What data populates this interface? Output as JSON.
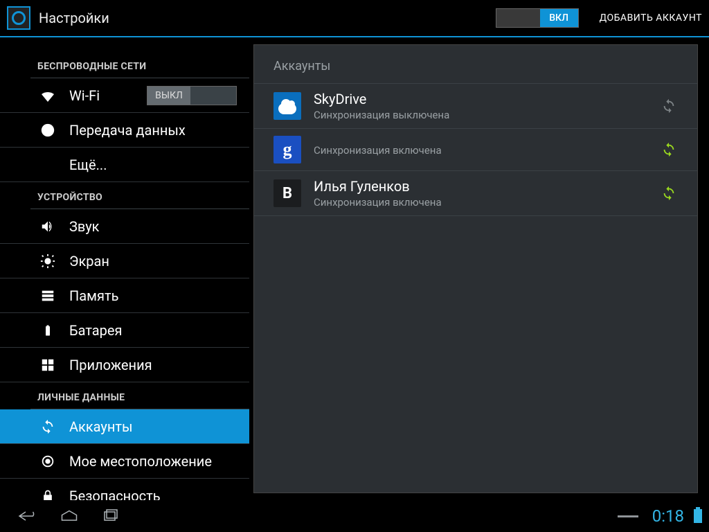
{
  "header": {
    "title": "Настройки",
    "toggle_on_label": "ВКЛ",
    "add_account": "ДОБАВИТЬ АККАУНТ"
  },
  "sidebar": {
    "section_wireless": "БЕСПРОВОДНЫЕ СЕТИ",
    "wifi": {
      "label": "Wi-Fi",
      "toggle_off": "ВЫКЛ"
    },
    "data_usage": "Передача данных",
    "more": "Ещё...",
    "section_device": "УСТРОЙСТВО",
    "sound": "Звук",
    "display": "Экран",
    "storage": "Память",
    "battery": "Батарея",
    "apps": "Приложения",
    "section_personal": "ЛИЧНЫЕ ДАННЫЕ",
    "accounts": "Аккаунты",
    "location": "Мое местоположение",
    "security": "Безопасность"
  },
  "content": {
    "title": "Аккаунты",
    "accounts": [
      {
        "name": "SkyDrive",
        "status": "Синхронизация выключена",
        "icon_key": "skydrive",
        "bg": "#0a6ebd",
        "sync": "off"
      },
      {
        "name": "",
        "status": "Синхронизация включена",
        "icon_key": "google",
        "bg": "#1a4fc1",
        "sync": "on",
        "glyph": "g"
      },
      {
        "name": "Илья Гуленков",
        "status": "Синхронизация включена",
        "icon_key": "vk",
        "bg": "#1b1d1f",
        "sync": "on",
        "glyph": "В"
      }
    ]
  },
  "navbar": {
    "clock": "0:18"
  }
}
